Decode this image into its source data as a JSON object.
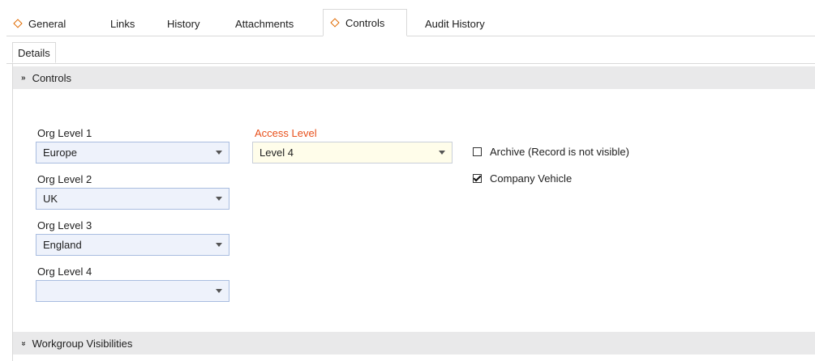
{
  "tabs": [
    {
      "label": "General",
      "marked": true
    },
    {
      "label": "Links"
    },
    {
      "label": "History"
    },
    {
      "label": "Attachments"
    },
    {
      "label": "Controls",
      "marked": true,
      "active": true
    },
    {
      "label": "Audit History"
    }
  ],
  "subtab": {
    "label": "Details"
  },
  "sections": {
    "controls": {
      "title": "Controls"
    },
    "workgroup": {
      "title": "Workgroup Visibilities"
    }
  },
  "fields": {
    "org1": {
      "label": "Org Level 1",
      "value": "Europe"
    },
    "org2": {
      "label": "Org Level 2",
      "value": "UK"
    },
    "org3": {
      "label": "Org Level 3",
      "value": "England"
    },
    "org4": {
      "label": "Org Level 4",
      "value": ""
    },
    "access": {
      "label": "Access Level",
      "value": "Level 4"
    }
  },
  "checkboxes": {
    "archive": {
      "label": "Archive (Record is not visible)",
      "checked": false
    },
    "vehicle": {
      "label": "Company Vehicle",
      "checked": true
    }
  },
  "colors": {
    "accent": "#e8501b",
    "marker": "#e06a00",
    "header_bg": "#e9e9ea",
    "field_bg": "#eef2fb",
    "required_bg": "#fffdea"
  }
}
